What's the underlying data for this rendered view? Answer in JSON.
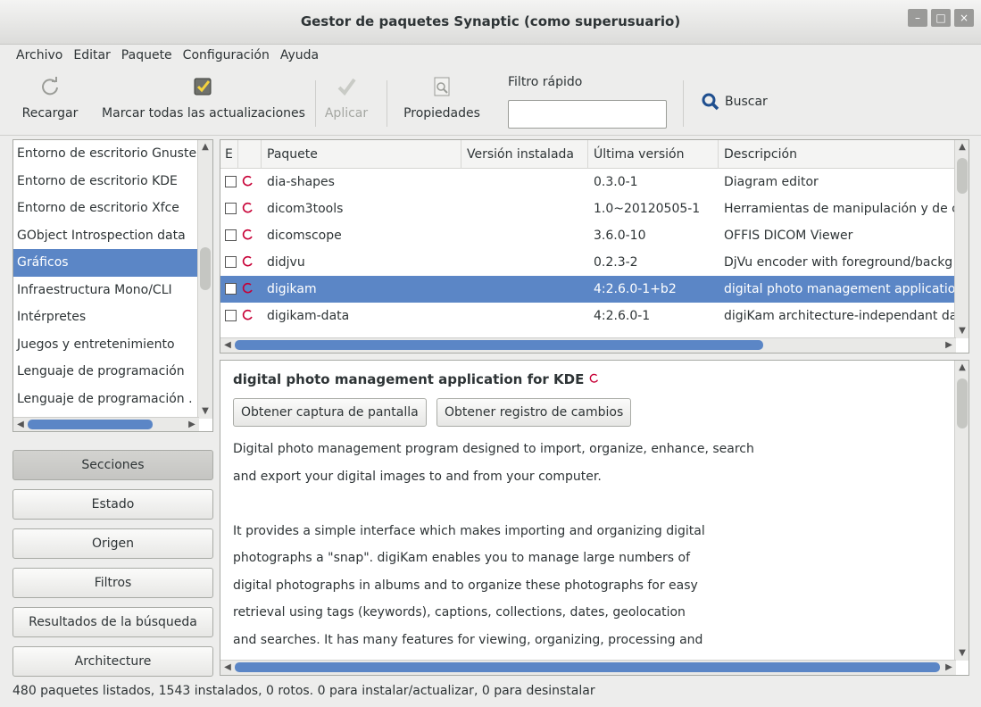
{
  "window": {
    "title": "Gestor de paquetes Synaptic  (como superusuario)",
    "controls": [
      "–",
      "□",
      "×"
    ]
  },
  "menu": [
    "Archivo",
    "Editar",
    "Paquete",
    "Configuración",
    "Ayuda"
  ],
  "toolbar": {
    "reload": "Recargar",
    "mark_all": "Marcar todas las actualizaciones",
    "apply": "Aplicar",
    "properties": "Propiedades",
    "quick_filter_label": "Filtro rápido",
    "quick_filter_value": "",
    "search": "Buscar"
  },
  "sections": {
    "items": [
      "Entorno de escritorio Gnustep",
      "Entorno de escritorio KDE",
      "Entorno de escritorio Xfce",
      "GObject Introspection data",
      "Gráficos",
      "Infraestructura Mono/CLI",
      "Intérpretes",
      "Juegos y entretenimiento",
      "Lenguaje de programación",
      "Lenguaje de programación ."
    ],
    "selected_index": 4
  },
  "side_buttons": [
    "Secciones",
    "Estado",
    "Origen",
    "Filtros",
    "Resultados de la búsqueda",
    "Architecture"
  ],
  "packages": {
    "columns": [
      "E",
      "Paquete",
      "Versión instalada",
      "Última versión",
      "Descripción"
    ],
    "rows": [
      {
        "name": "dia-shapes",
        "installed": "",
        "latest": "0.3.0-1",
        "description": "Diagram editor"
      },
      {
        "name": "dicom3tools",
        "installed": "",
        "latest": "1.0~20120505-1",
        "description": "Herramientas de manipulación y de c"
      },
      {
        "name": "dicomscope",
        "installed": "",
        "latest": "3.6.0-10",
        "description": "OFFIS DICOM Viewer"
      },
      {
        "name": "didjvu",
        "installed": "",
        "latest": "0.2.3-2",
        "description": "DjVu encoder with foreground/backg"
      },
      {
        "name": "digikam",
        "installed": "",
        "latest": "4:2.6.0-1+b2",
        "description": "digital photo management application"
      },
      {
        "name": "digikam-data",
        "installed": "",
        "latest": "4:2.6.0-1",
        "description": "digiKam architecture-independant da"
      }
    ],
    "selected_index": 4
  },
  "details": {
    "title": "digital photo management application for KDE",
    "screenshot_button": "Obtener captura de pantalla",
    "changelog_button": "Obtener registro de cambios",
    "lines": [
      "Digital photo management program designed to import, organize, enhance, search",
      "and export your digital images to and from your computer.",
      "",
      "It provides a simple interface which makes importing and organizing digital",
      "photographs a \"snap\". digiKam enables you to manage large numbers of",
      "digital photographs in albums and to organize these photographs for easy",
      "retrieval using tags (keywords), captions, collections, dates, geolocation",
      "and searches. It has many features for viewing, organizing, processing and"
    ]
  },
  "status": "480 paquetes listados, 1543 instalados, 0 rotos. 0 para instalar/actualizar, 0 para desinstalar",
  "colors": {
    "selection": "#5b86c6",
    "debian": "#c70036"
  }
}
